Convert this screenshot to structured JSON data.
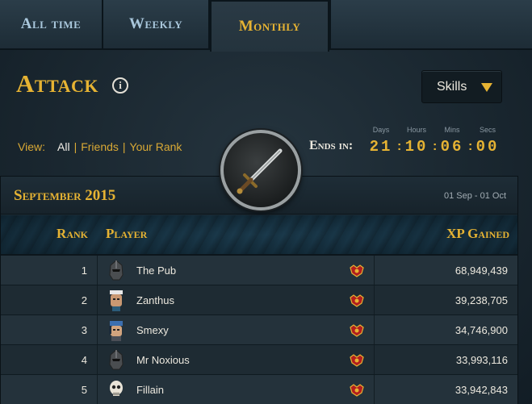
{
  "tabs": [
    {
      "label": "All time"
    },
    {
      "label": "Weekly"
    },
    {
      "label": "Monthly"
    }
  ],
  "active_tab": "Monthly",
  "header": {
    "skill_name": "Attack",
    "info_icon": "i",
    "skills_dropdown": "Skills"
  },
  "view": {
    "label": "View:",
    "options": [
      "All",
      "Friends",
      "Your Rank"
    ],
    "current": "All"
  },
  "countdown": {
    "label": "Ends in:",
    "units": [
      {
        "label": "Days",
        "value": "21"
      },
      {
        "label": "Hours",
        "value": "10"
      },
      {
        "label": "Mins",
        "value": "06"
      },
      {
        "label": "Secs",
        "value": "00"
      }
    ]
  },
  "medallion_icon": "sword-icon",
  "panel": {
    "month": "September 2015",
    "range": "01 Sep - 01 Oct",
    "columns": {
      "rank": "Rank",
      "player": "Player",
      "xp": "XP Gained"
    }
  },
  "rows": [
    {
      "rank": "1",
      "player": "The Pub",
      "xp": "68,949,439",
      "avatar": "helm-avatar"
    },
    {
      "rank": "2",
      "player": "Zanthus",
      "xp": "39,238,705",
      "avatar": "face-avatar"
    },
    {
      "rank": "3",
      "player": "Smexy",
      "xp": "34,746,900",
      "avatar": "bandana-avatar"
    },
    {
      "rank": "4",
      "player": "Mr Noxious",
      "xp": "33,993,116",
      "avatar": "helm-avatar"
    },
    {
      "rank": "5",
      "player": "Fillain",
      "xp": "33,942,843",
      "avatar": "skull-avatar"
    }
  ],
  "colors": {
    "accent": "#e6b333",
    "text": "#ece8de",
    "link_blue": "#a9c7dc"
  }
}
